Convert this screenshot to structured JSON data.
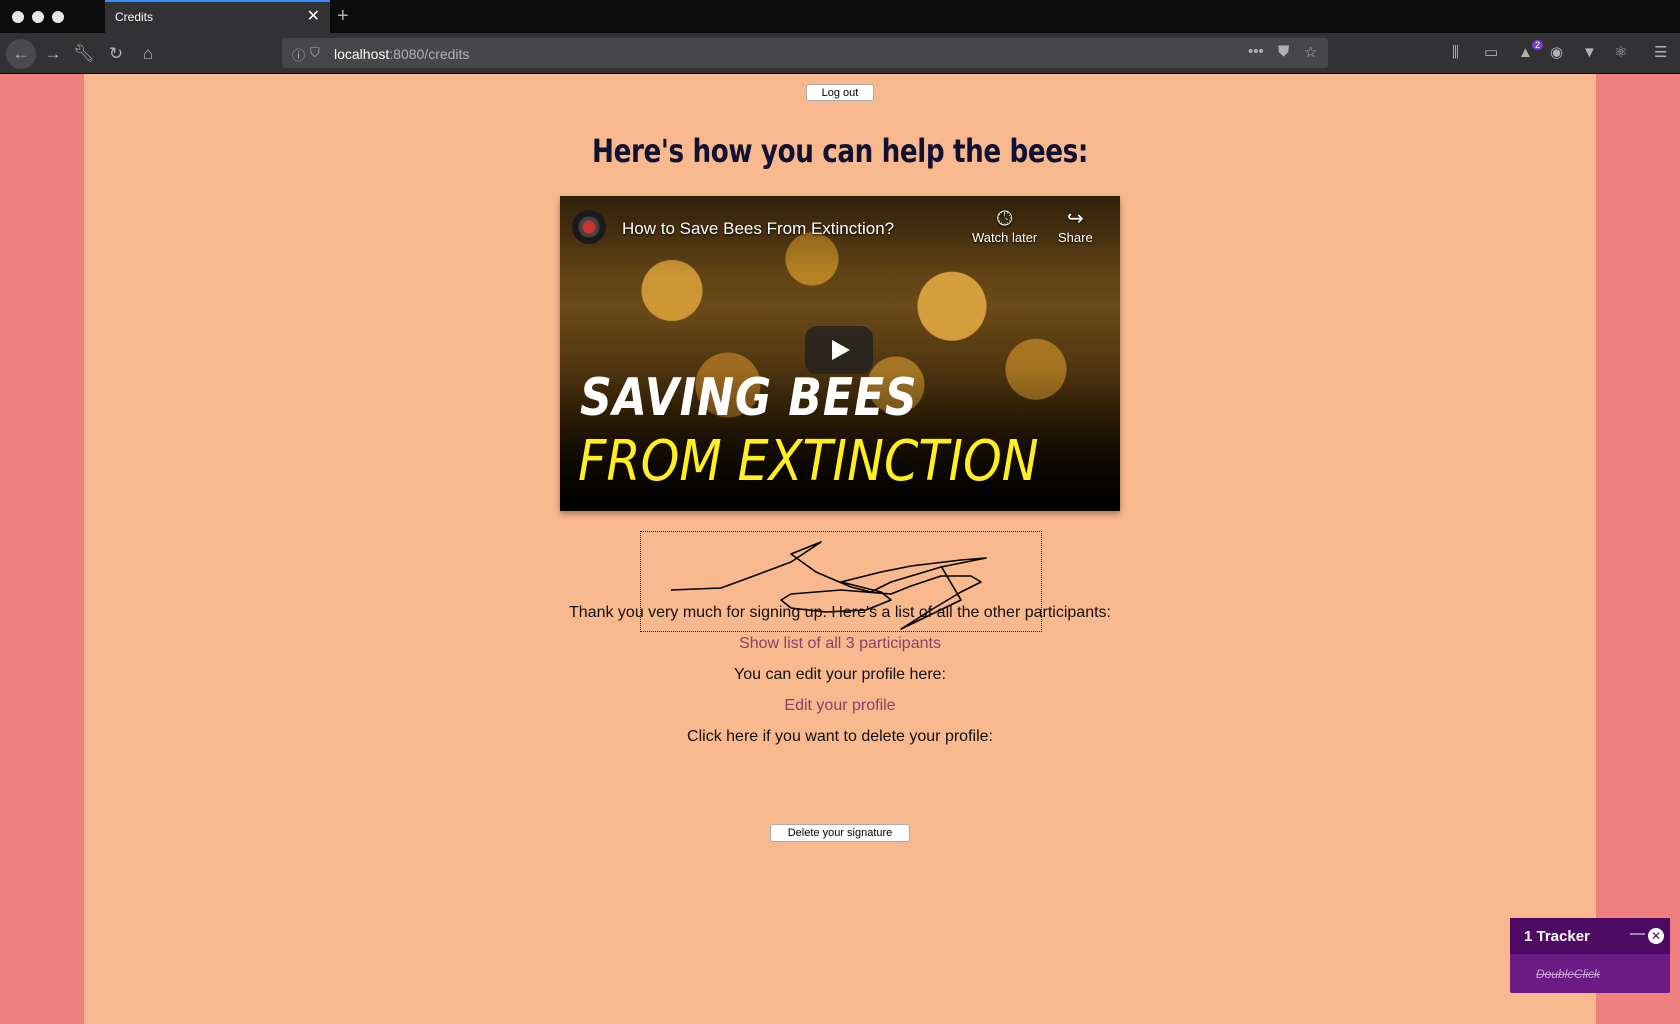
{
  "browser": {
    "tab_title": "Credits",
    "tab_close": "✕",
    "new_tab": "+",
    "url_host": "localhost",
    "url_rest": ":8080/credits",
    "profile_badge": "2",
    "icons": [
      "back-arrow",
      "forward-arrow",
      "wrench",
      "reload",
      "home",
      "info",
      "shield",
      "more-dots",
      "pocket",
      "bookmark-star",
      "library",
      "sidebar",
      "extension-badge",
      "account",
      "vue",
      "react",
      "menu"
    ]
  },
  "page": {
    "logout_label": "Log out",
    "headline": "Here's how you can help the bees:",
    "video": {
      "title": "How to Save Bees From Extinction?",
      "watch_later": "Watch later",
      "share": "Share",
      "overlay_line1": "SAVING BEES",
      "overlay_line2": "FROM EXTINCTION"
    },
    "thank_you": "Thank you very much for signing up. Here's a list of all the other participants:",
    "participants_link": "Show list of all 3 participants",
    "edit_prompt": "You can edit your profile here:",
    "edit_link": "Edit your profile",
    "delete_prompt": "Click here if you want to delete your profile:",
    "delete_label": "Delete your signature"
  },
  "tracker": {
    "title": "1 Tracker",
    "minimize": "—",
    "close": "✕",
    "item": "DoubleClick"
  },
  "colors": {
    "page_bg": "#f9b98f",
    "body_bg": "#f08080",
    "link": "#8a3f6b",
    "headline": "#111133",
    "tracker_bg": "#6b1a86"
  }
}
